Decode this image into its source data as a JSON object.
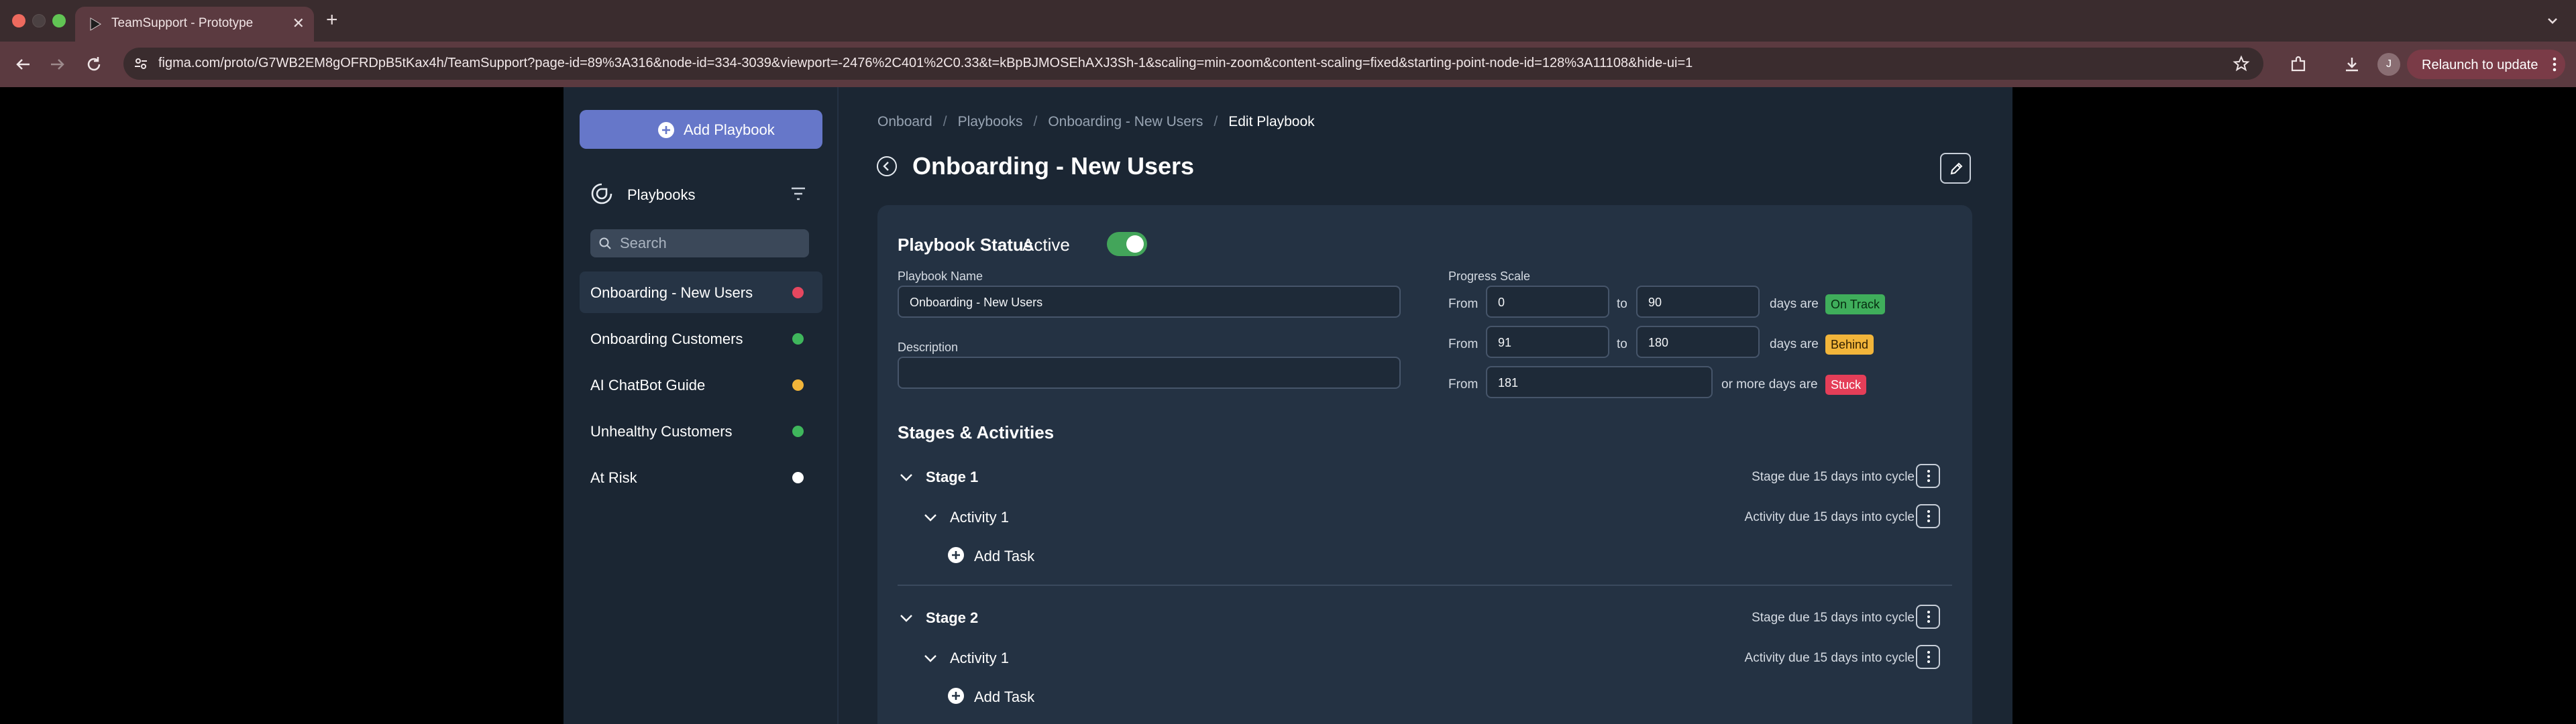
{
  "browser": {
    "tab_title": "TeamSupport - Prototype",
    "url": "figma.com/proto/G7WB2EM8gOFRDpB5tKax4h/TeamSupport?page-id=89%3A316&node-id=334-3039&viewport=-2476%2C401%2C0.33&t=kBpBJMOSEhAXJ3Sh-1&scaling=min-zoom&content-scaling=fixed&starting-point-node-id=128%3A11108&hide-ui=1",
    "profile_initial": "J",
    "relaunch_label": "Relaunch to update"
  },
  "sidebar": {
    "add_button_label": "Add Playbook",
    "section_title": "Playbooks",
    "search_placeholder": "Search",
    "items": [
      {
        "label": "Onboarding - New Users",
        "status_color": "#e5475f",
        "active": true
      },
      {
        "label": "Onboarding Customers",
        "status_color": "#3fb65c",
        "active": false
      },
      {
        "label": "AI ChatBot Guide",
        "status_color": "#f2b53a",
        "active": false
      },
      {
        "label": "Unhealthy Customers",
        "status_color": "#3fb65c",
        "active": false
      },
      {
        "label": "At Risk",
        "status_color": "#ffffff",
        "active": false
      }
    ]
  },
  "breadcrumb": [
    "Onboard",
    "Playbooks",
    "Onboarding - New Users",
    "Edit Playbook"
  ],
  "page_title": "Onboarding - New Users",
  "status": {
    "label": "Playbook Status",
    "value": "Active",
    "enabled": true
  },
  "form": {
    "name_label": "Playbook Name",
    "name_value": "Onboarding - New Users",
    "description_label": "Description",
    "description_value": ""
  },
  "progress": {
    "label": "Progress Scale",
    "from_label": "From",
    "to_label": "to",
    "days_are": "days are",
    "more_days_are": "or more days are",
    "rows": [
      {
        "from": "0",
        "to": "90",
        "badge": "On Track"
      },
      {
        "from": "91",
        "to": "180",
        "badge": "Behind"
      },
      {
        "from": "181",
        "badge": "Stuck"
      }
    ]
  },
  "stages_title": "Stages & Activities",
  "stages": [
    {
      "label": "Stage 1",
      "due": "Stage due 15 days into cycle",
      "activity": "Activity 1",
      "activity_due": "Activity due 15 days into cycle",
      "add_task": "Add Task"
    },
    {
      "label": "Stage 2",
      "due": "Stage due 15 days into cycle",
      "activity": "Activity 1",
      "activity_due": "Activity due 15 days into cycle",
      "add_task": "Add Task"
    }
  ],
  "colors": {
    "accent": "#6677c9",
    "toggle_on": "#43a55a",
    "panel": "#243243",
    "background": "#1b2633"
  }
}
